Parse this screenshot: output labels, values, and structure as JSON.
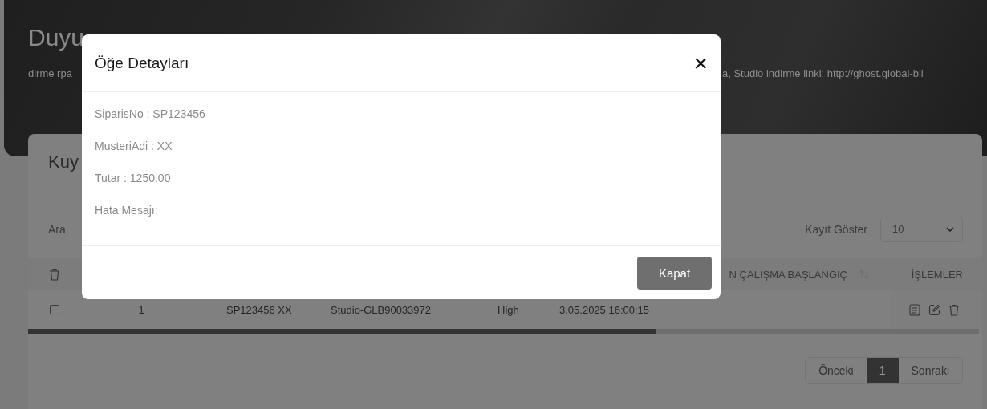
{
  "page": {
    "title": "Duyu",
    "announcement_left": "dirme rpa",
    "announcement_right": "a, Studio indirme linki: http://ghost.global-bil"
  },
  "card": {
    "title": "Kuy",
    "search_label": "Ara",
    "page_size_label": "Kayıt Göster",
    "page_size": "10"
  },
  "table": {
    "sort_column_label": "N ÇALIŞMA BAŞLANGIÇ",
    "actions_label": "İŞLEMLER",
    "rows": [
      {
        "checked": false,
        "cells": [
          "1",
          "SP123456 XX",
          "Studio-GLB90033972",
          "High",
          "3.05.2025 16:00:15"
        ]
      }
    ]
  },
  "pagination": {
    "previous": "Önceki",
    "next": "Sonraki",
    "pages": [
      {
        "label": "1",
        "selected": true
      }
    ]
  },
  "modal": {
    "title": "Öğe Detayları",
    "close": "×",
    "fields": [
      "SiparisNo : SP123456",
      "MusteriAdi : XX",
      "Tutar : 1250.00",
      "Hata Mesajı:"
    ],
    "button": "Kapat"
  }
}
